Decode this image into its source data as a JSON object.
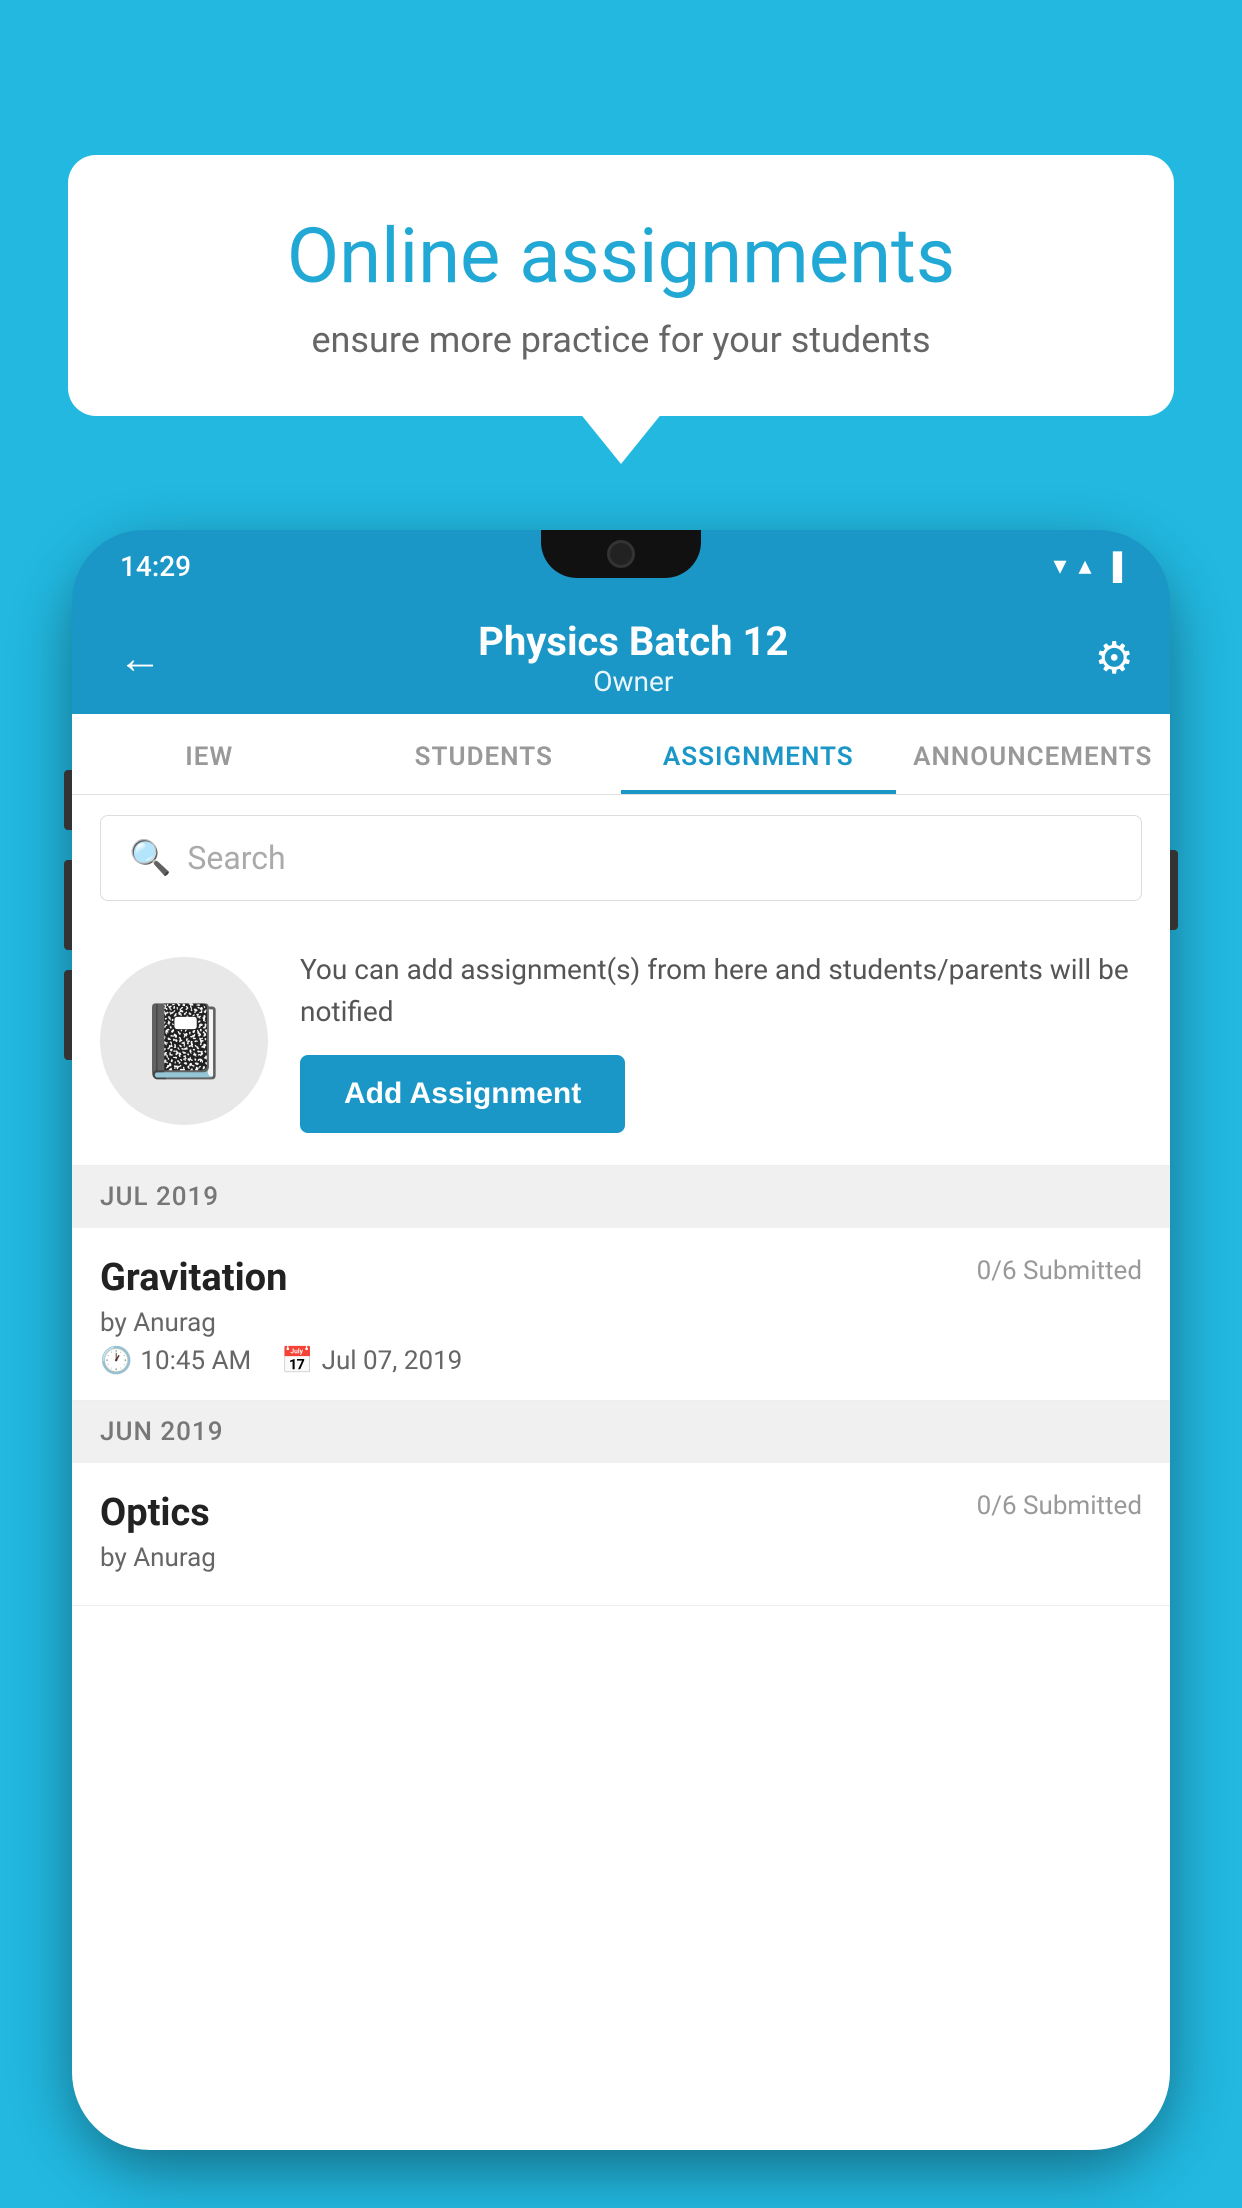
{
  "background_color": "#22b8e0",
  "speech_bubble": {
    "title": "Online assignments",
    "subtitle": "ensure more practice for your students"
  },
  "status_bar": {
    "time": "14:29",
    "wifi_icon": "▼",
    "signal_icon": "▲",
    "battery_icon": "▌"
  },
  "app_bar": {
    "title": "Physics Batch 12",
    "subtitle": "Owner",
    "back_icon": "←",
    "settings_icon": "⚙"
  },
  "tabs": [
    {
      "label": "IEW",
      "active": false
    },
    {
      "label": "STUDENTS",
      "active": false
    },
    {
      "label": "ASSIGNMENTS",
      "active": true
    },
    {
      "label": "ANNOUNCEMENTS",
      "active": false
    }
  ],
  "search": {
    "placeholder": "Search"
  },
  "promo_card": {
    "description": "You can add assignment(s) from here and students/parents will be notified",
    "button_label": "Add Assignment"
  },
  "assignment_sections": [
    {
      "month": "JUL 2019",
      "assignments": [
        {
          "name": "Gravitation",
          "submitted": "0/6 Submitted",
          "by": "by Anurag",
          "time": "10:45 AM",
          "date": "Jul 07, 2019"
        }
      ]
    },
    {
      "month": "JUN 2019",
      "assignments": [
        {
          "name": "Optics",
          "submitted": "0/6 Submitted",
          "by": "by Anurag",
          "time": "",
          "date": ""
        }
      ]
    }
  ]
}
